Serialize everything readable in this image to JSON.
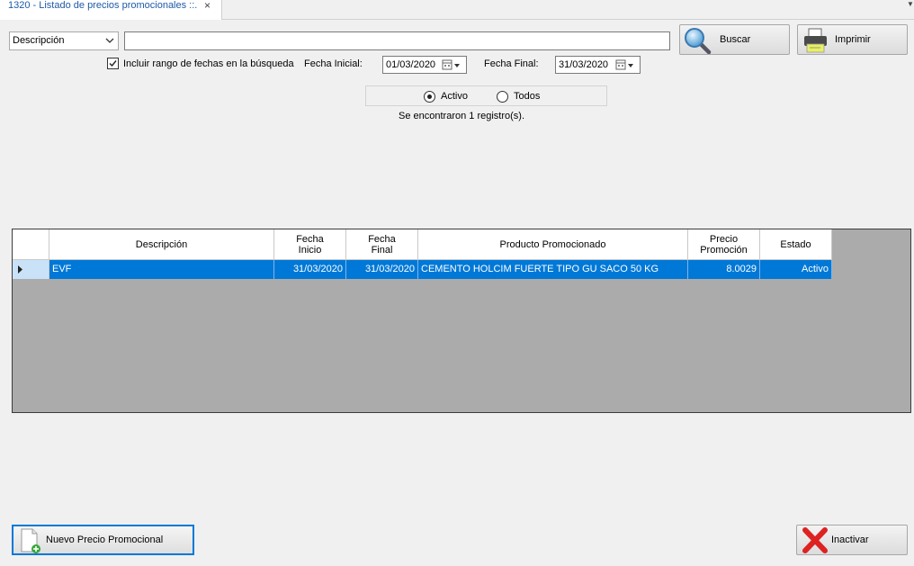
{
  "tab": {
    "title": "1320 - Listado de precios promocionales ::.",
    "close": "×"
  },
  "filter": {
    "field_selected": "Descripción",
    "search_value": "",
    "search_placeholder": "",
    "buscar_label": "Buscar",
    "imprimir_label": "Imprimir",
    "include_range_label": "Incluir rango de fechas en la búsqueda",
    "include_range_checked": true,
    "fecha_inicial_label": "Fecha Inicial:",
    "fecha_inicial": "01/03/2020",
    "fecha_final_label": "Fecha Final:",
    "fecha_final": "31/03/2020"
  },
  "status_filter": {
    "options": [
      "Activo",
      "Todos"
    ],
    "selected": "Activo"
  },
  "result_text": "Se encontraron 1 registro(s).",
  "grid": {
    "columns": [
      "Descripción",
      "Fecha Inicio",
      "Fecha Final",
      "Producto Promocionado",
      "Precio Promoción",
      "Estado"
    ],
    "rows": [
      [
        "EVF",
        "31/03/2020",
        "31/03/2020",
        "CEMENTO HOLCIM FUERTE TIPO GU SACO 50 KG",
        "8.0029",
        "Activo"
      ]
    ]
  },
  "footer": {
    "nuevo_label": "Nuevo Precio Promocional",
    "inactivar_label": "Inactivar"
  },
  "colors": {
    "selection": "#0078d7",
    "grid_bg": "#ababab",
    "tab_text": "#1e5aa8"
  }
}
